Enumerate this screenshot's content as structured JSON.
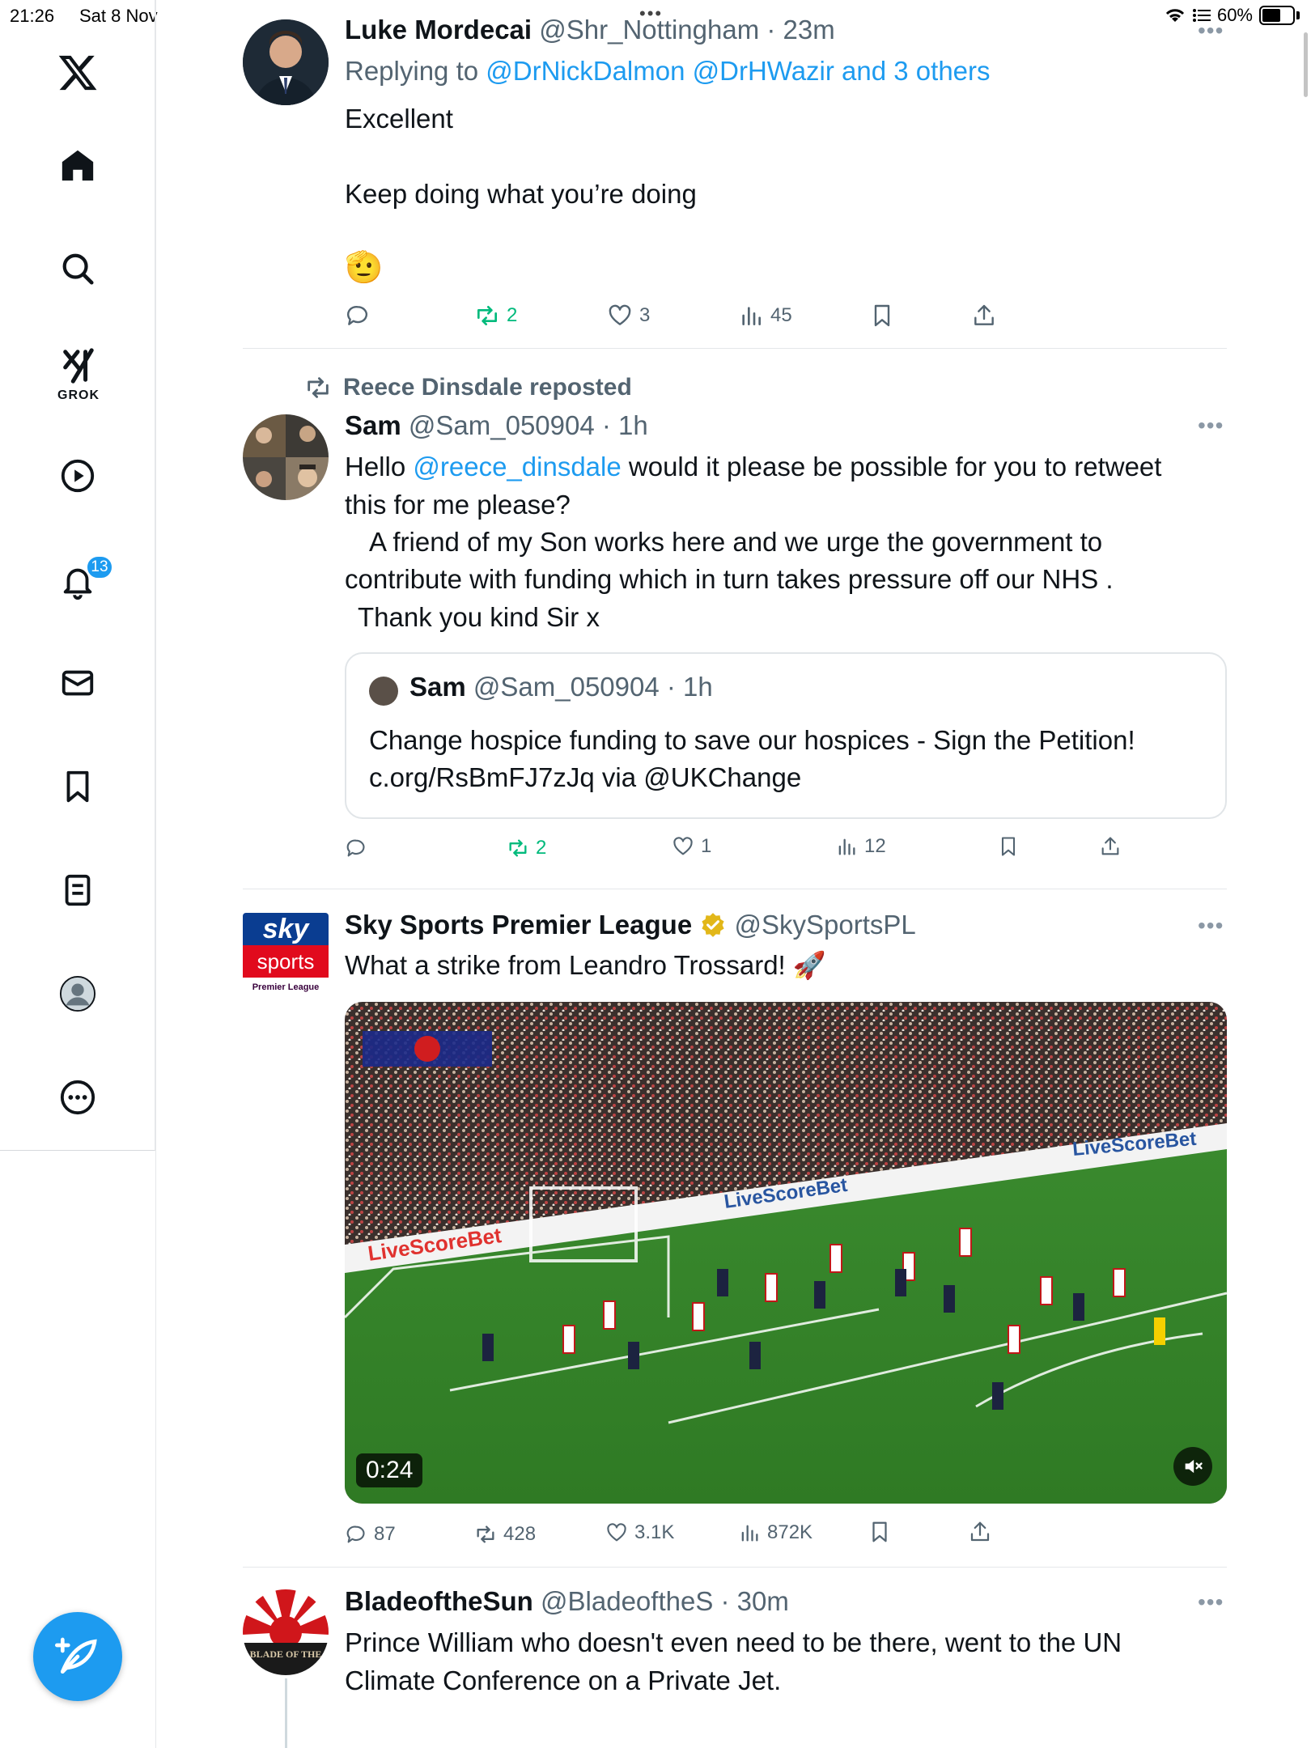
{
  "status_bar": {
    "time": "21:26",
    "date": "Sat 8 Nov",
    "battery": "60%"
  },
  "sidebar": {
    "grok_label": "GROK",
    "notifications_badge": "13"
  },
  "tweets": [
    {
      "name": "Luke Mordecai",
      "handle": "@Shr_Nottingham",
      "time": "23m",
      "replying_prefix": "Replying to ",
      "replying_to": "@DrNickDalmon @DrHWazir and 3 others",
      "lines": [
        "Excellent",
        "Keep doing what you’re doing",
        "🫡"
      ],
      "actions": {
        "replies": "",
        "reposts": "2",
        "likes": "3",
        "views": "45"
      }
    },
    {
      "reposted_by": "Reece Dinsdale reposted",
      "name": "Sam",
      "handle": "@Sam_050904",
      "time": "1h",
      "line1_a": "Hello ",
      "line1_mention": "@reece_dinsdale",
      "line1_b": " would it please be possible for you to retweet",
      "line2": "this for me please?",
      "line3": "A friend of my Son works here and we urge the government to",
      "line4": "contribute with funding which in turn takes pressure off our NHS .",
      "line5": "Thank you kind Sir x",
      "quote": {
        "name": "Sam",
        "handle": "@Sam_050904",
        "time": "1h",
        "line1": "Change hospice funding to save our hospices - Sign the Petition!",
        "line2": "c.org/RsBmFJ7zJq via @UKChange"
      },
      "actions": {
        "replies": "",
        "reposts": "2",
        "likes": "1",
        "views": "12"
      }
    },
    {
      "name": "Sky Sports Premier League",
      "handle": "@SkySportsPL",
      "text": "What a strike from Leandro Trossard! 🚀",
      "avatar_top": "sky",
      "avatar_mid": "sports",
      "avatar_bottom": "Premier League",
      "video_duration": "0:24",
      "board_text": "LiveScoreBet",
      "actions": {
        "replies": "87",
        "reposts": "428",
        "likes": "3.1K",
        "views": "872K"
      }
    },
    {
      "name": "BladeoftheSun",
      "handle": "@BladeoftheS",
      "time": "30m",
      "line1": "Prince William who doesn't even need to be there, went to the UN",
      "line2": "Climate Conference on a Private Jet.",
      "avatar_text": "BLADE OF THE"
    }
  ],
  "colors": {
    "accent": "#1d9bf0",
    "repost_green": "#00ba7c",
    "muted": "#536471"
  }
}
